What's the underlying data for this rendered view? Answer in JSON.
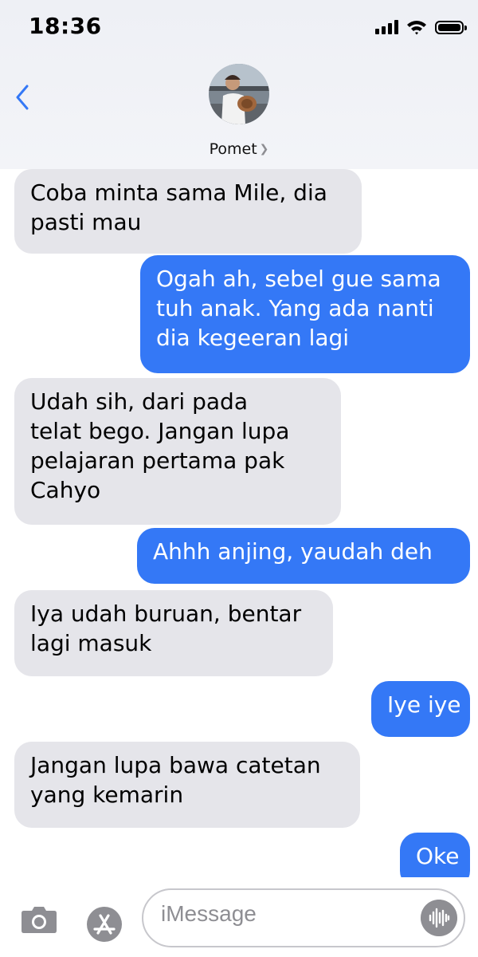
{
  "status_bar": {
    "time": "18:36",
    "icons": [
      "signal-icon",
      "wifi-icon",
      "battery-icon"
    ]
  },
  "header": {
    "contact_name": "Pomet",
    "back_icon": "chevron-left-icon",
    "disclosure_icon": "chevron-right-icon"
  },
  "messages": [
    {
      "direction": "incoming",
      "lines": [
        "Coba minta sama Mile, dia",
        "pasti mau"
      ]
    },
    {
      "direction": "outgoing",
      "lines": [
        "Ogah ah, sebel gue sama",
        "tuh anak. Yang ada nanti",
        "dia kegeeran lagi"
      ]
    },
    {
      "direction": "incoming",
      "lines": [
        "Udah sih, dari pada",
        "telat bego. Jangan lupa",
        "pelajaran pertama pak",
        "Cahyo"
      ]
    },
    {
      "direction": "outgoing",
      "lines": [
        "Ahhh anjing, yaudah deh"
      ]
    },
    {
      "direction": "incoming",
      "lines": [
        "Iya udah buruan, bentar",
        "lagi masuk"
      ]
    },
    {
      "direction": "outgoing",
      "lines": [
        "Iye iye"
      ]
    },
    {
      "direction": "incoming",
      "lines": [
        "Jangan lupa bawa catetan",
        "yang kemarin"
      ]
    },
    {
      "direction": "outgoing",
      "lines": [
        "Oke"
      ]
    }
  ],
  "composer": {
    "placeholder": "iMessage",
    "icons": [
      "camera-icon",
      "app-store-icon",
      "audio-waveform-icon"
    ]
  },
  "colors": {
    "incoming_bubble": "#e5e5ea",
    "outgoing_bubble": "#3478f6",
    "accent": "#3478f6"
  }
}
